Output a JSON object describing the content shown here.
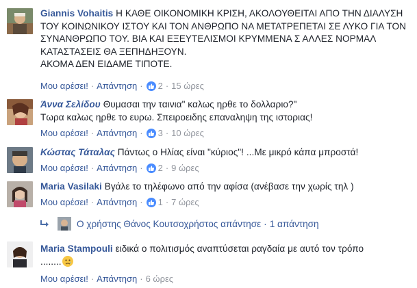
{
  "comments": [
    {
      "author": "Giannis Vohaitis",
      "text": "Η ΚΑΘΕ ΟΙΚΟΝΟΜΙΚΗ ΚΡΙΣΗ, ΑΚΟΛΟΥΘΕΙΤΑΙ ΑΠΟ ΤΗΝ ΔΙΑΛΥΣΗ ΤΟΥ ΚΟΙΝΩΝΙΚΟΥ ΙΣΤΟΥ ΚΑΙ ΤΟΝ ΑΝΘΡΩΠΟ ΝΑ ΜΕΤΑΤΡΕΠΕΤΑΙ ΣΕ ΛΥΚΟ ΓΙΑ ΤΟΝ ΣΥΝΑΝΘΡΩΠΟ ΤΟΥ. ΒΙΑ ΚΑΙ ΕΞΕΥΤΕΛΙΣΜΟΙ ΚΡΥΜΜΕΝΑ Σ ΑΛΛΕΣ ΝΟΡΜΑΛ ΚΑΤΑΣΤΑΣΕΙΣ ΘΑ ΞΕΠΗΔΗΞΟΥΝ.\nΑΚΟΜΑ ΔΕΝ ΕΙΔΑΜΕ ΤΙΠΟΤΕ.",
      "like_label": "Μου αρέσει!",
      "reply_label": "Απάντηση",
      "like_count": "2",
      "time": "15 ώρες",
      "avatar_icon": "avatar-photo"
    },
    {
      "author": "Άννα Σελίδου",
      "text": "Θυμασαι την ταινια\" καλως ηρθε το δολλαριο?\"\nΤωρα καλως ηρθε το ευρω. Σπειροειδης επαναληψη της ιστοριας!",
      "like_label": "Μου αρέσει!",
      "reply_label": "Απάντηση",
      "like_count": "3",
      "time": "10 ώρες",
      "avatar_icon": "avatar-photo"
    },
    {
      "author": "Κώστας Τάταλας",
      "text": "Πάντως ο Ηλίας είναι \"κύριος\"! ...Με μικρό κάπα μπροστά!",
      "like_label": "Μου αρέσει!",
      "reply_label": "Απάντηση",
      "like_count": "2",
      "time": "9 ώρες",
      "avatar_icon": "avatar-photo"
    },
    {
      "author": "Maria Vasilaki",
      "text": "Βγάλε το τηλέφωνο από την αφίσα (ανέβασε την χωρίς τηλ )",
      "like_label": "Μου αρέσει!",
      "reply_label": "Απάντηση",
      "like_count": "1",
      "time": "7 ώρες",
      "avatar_icon": "avatar-photo"
    },
    {
      "author": "Maria Stampouli",
      "text": "ειδικά ο πολιτισμός αναπτύσεται ραγδαία με αυτό τον τρόπο\n........",
      "like_label": "Μου αρέσει!",
      "reply_label": "Απάντηση",
      "time": "6 ώρες",
      "avatar_icon": "avatar-photo"
    }
  ],
  "reply_summary": {
    "text": "Ο χρήστης Θάνος Κουτσοχρήστος απάντησε",
    "count_text": "1 απάντηση",
    "dot": "·",
    "icon": "reply-arrow-icon"
  },
  "meta_separator": "·",
  "colors": {
    "link": "#365899",
    "muted": "#90949c",
    "like_badge": "#4a8cff"
  }
}
